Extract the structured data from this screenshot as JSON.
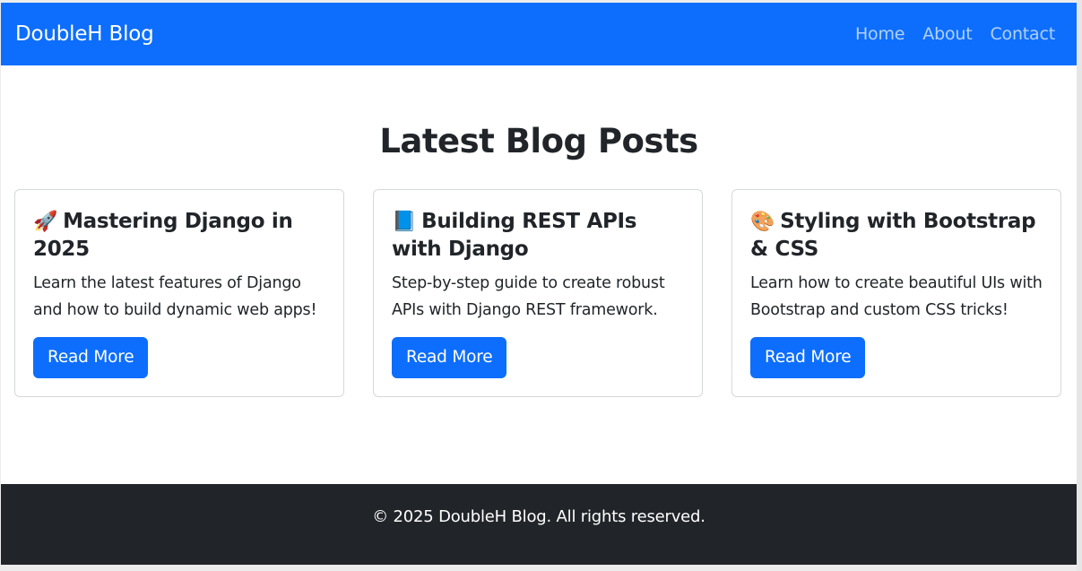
{
  "navbar": {
    "brand": "DoubleH Blog",
    "links": [
      "Home",
      "About",
      "Contact"
    ]
  },
  "main": {
    "title": "Latest Blog Posts",
    "posts": [
      {
        "icon": "🚀",
        "icon_name": "rocket-icon",
        "title": "Mastering Django in 2025",
        "text": "Learn the latest features of Django and how to build dynamic web apps!",
        "button": "Read More"
      },
      {
        "icon": "📘",
        "icon_name": "blue-book-icon",
        "title": "Building REST APIs with Django",
        "text": "Step-by-step guide to create robust APIs with Django REST framework.",
        "button": "Read More"
      },
      {
        "icon": "🎨",
        "icon_name": "palette-icon",
        "title": "Styling with Bootstrap & CSS",
        "text": "Learn how to create beautiful UIs with Bootstrap and custom CSS tricks!",
        "button": "Read More"
      }
    ]
  },
  "footer": {
    "text": "© 2025 DoubleH Blog. All rights reserved."
  },
  "colors": {
    "primary": "#0d6efd",
    "dark": "#212529",
    "card_border": "#d5d8dc"
  }
}
